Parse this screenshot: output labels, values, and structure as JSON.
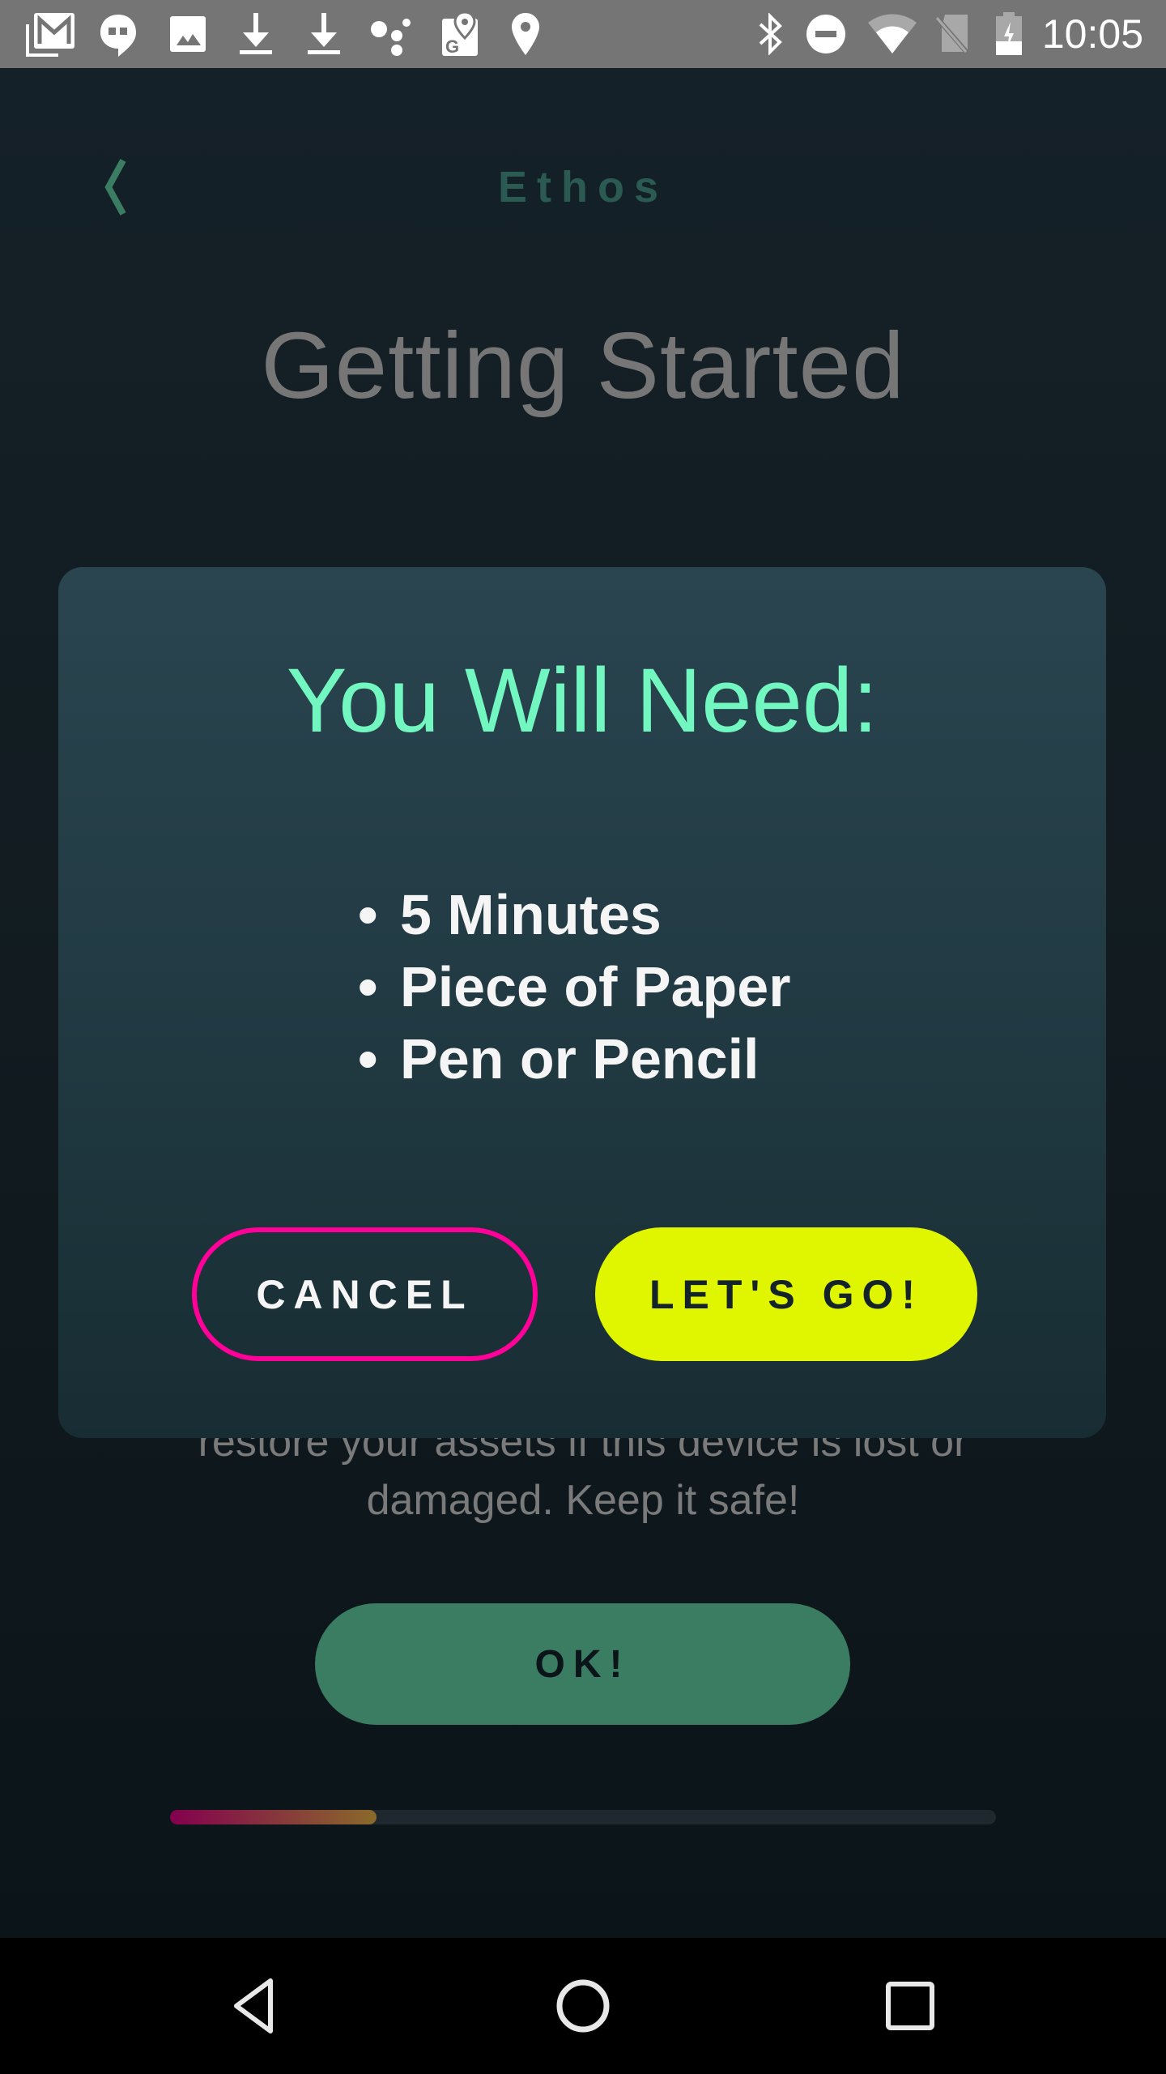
{
  "status_bar": {
    "left_icons": [
      "gmail-icon",
      "hangouts-icon",
      "photos-icon",
      "download-icon",
      "download-icon",
      "assistant-icon",
      "maps-icon",
      "location-pin-icon"
    ],
    "right_icons": [
      "bluetooth-icon",
      "do-not-disturb-icon",
      "wifi-icon",
      "no-sim-icon",
      "battery-charging-icon"
    ],
    "time": "10:05"
  },
  "header": {
    "back_icon": "chevron-left-icon",
    "app_title": "Ethos"
  },
  "page": {
    "title": "Getting Started",
    "background_text_line1": "restore your assets if this device is lost or",
    "background_text_line2": "damaged. Keep it safe!",
    "ok_button": "OK!",
    "progress": 0.25
  },
  "modal": {
    "title": "You Will Need:",
    "items": [
      "5 Minutes",
      "Piece of Paper",
      "Pen or Pencil"
    ],
    "bullet": "•",
    "cancel_button": "CANCEL",
    "confirm_button": "LET'S GO!"
  },
  "nav_bar": {
    "back": "back-triangle-icon",
    "home": "home-circle-icon",
    "recents": "recents-square-icon"
  },
  "colors": {
    "accent_mint": "#72f7c1",
    "accent_lime": "#e0f500",
    "accent_pink": "#ff0099",
    "accent_green": "#3b7d62",
    "brand_title": "#2a5a52"
  }
}
